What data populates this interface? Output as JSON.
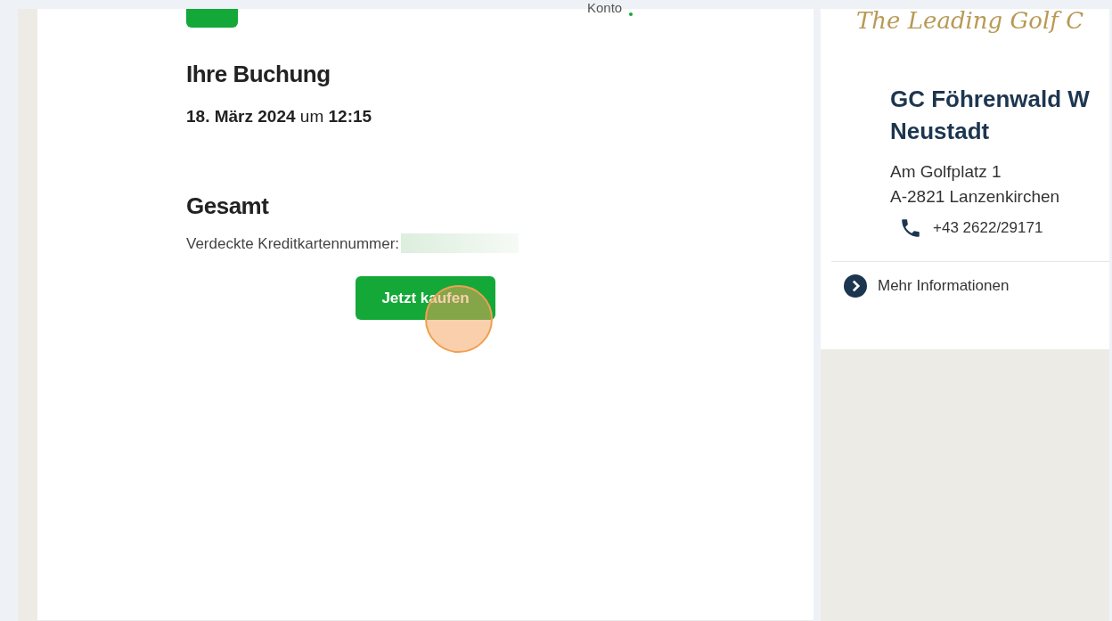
{
  "header": {
    "account_label": "Konto"
  },
  "booking": {
    "title": "Ihre Buchung",
    "date": "18. März 2024",
    "connector": "um",
    "time": "12:15"
  },
  "total": {
    "title": "Gesamt",
    "card_label": "Verdeckte Kreditkartennummer:",
    "button": "Jetzt kaufen",
    "click_marker": true
  },
  "club": {
    "logo_text": "The Leading Golf C",
    "name": "GC Föhrenwald W Neustadt",
    "address": [
      "Am Golfplatz 1",
      "A-2821 Lanzenkirchen"
    ],
    "phone": "+43 2622/29171",
    "more_link": "Mehr Informationen"
  }
}
